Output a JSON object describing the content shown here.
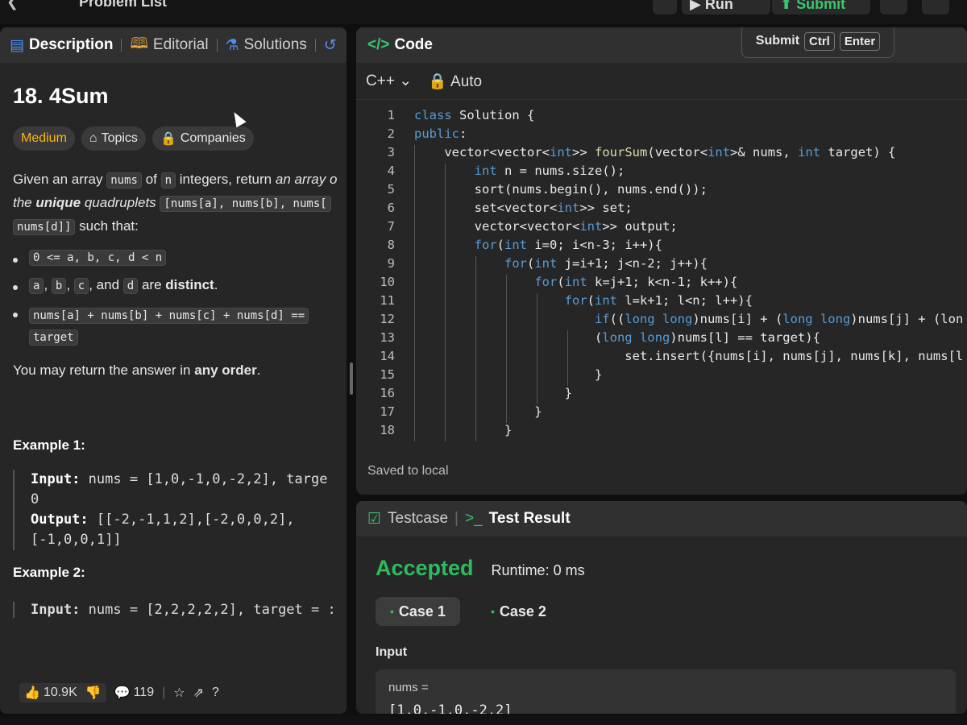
{
  "topbar": {
    "problem_list": "Problem List",
    "run": "Run",
    "submit": "Submit"
  },
  "left_tabs": [
    {
      "label": "Description",
      "icon": "document-icon"
    },
    {
      "label": "Editorial",
      "icon": "book-icon"
    },
    {
      "label": "Solutions",
      "icon": "flask-icon"
    },
    {
      "label": "",
      "icon": "history-icon"
    }
  ],
  "problem": {
    "title": "18. 4Sum",
    "difficulty": "Medium",
    "topics": "Topics",
    "companies": "Companies",
    "desc_1": "Given an array",
    "desc_nums": "nums",
    "desc_of": "of",
    "desc_n": "n",
    "desc_2": "integers, return",
    "desc_3": "an array o",
    "desc_4": "the",
    "desc_unique": "unique",
    "desc_5": "quadruplets",
    "desc_quad": "[nums[a], nums[b], nums[",
    "desc_quad2": "nums[d]]",
    "desc_6": "such that:",
    "bullet1": "0 <= a, b, c, d < n",
    "b2_a": "a",
    "b2_b": "b",
    "b2_c": "c",
    "b2_and": "and",
    "b2_d": "d",
    "b2_are": "are",
    "b2_distinct": "distinct",
    "bullet3": "nums[a] + nums[b] + nums[c] + nums[d] ==",
    "bullet3b": "target",
    "order_1": "You may return the answer in",
    "order_2": "any order",
    "example1_title": "Example 1:",
    "ex1_input_label": "Input:",
    "ex1_input": "nums = [1,0,-1,0,-2,2], targe",
    "ex1_input2": "0",
    "ex1_output_label": "Output:",
    "ex1_output": "[[-2,-1,1,2],[-2,0,0,2],",
    "ex1_output2": "[-1,0,0,1]]",
    "example2_title": "Example 2:",
    "ex2_input_label": "Input:",
    "ex2_input": "nums = [2,2,2,2,2], target = :"
  },
  "left_footer": {
    "likes": "10.9K",
    "comments": "119"
  },
  "code_panel": {
    "title": "Code",
    "submit_tip": "Submit",
    "kbd_ctrl": "Ctrl",
    "kbd_enter": "Enter",
    "language": "C++",
    "mode": "Auto",
    "saved": "Saved to local"
  },
  "code_lines": [
    "class Solution {",
    "public:",
    "    vector<vector<int>> fourSum(vector<int>& nums, int target) {",
    "        int n = nums.size();",
    "        sort(nums.begin(), nums.end());",
    "        set<vector<int>> set;",
    "        vector<vector<int>> output;",
    "        for(int i=0; i<n-3; i++){",
    "            for(int j=i+1; j<n-2; j++){",
    "                for(int k=j+1; k<n-1; k++){",
    "                    for(int l=k+1; l<n; l++){",
    "                        if((long long)nums[i] + (long long)nums[j] + (lon",
    "                        (long long)nums[l] == target){",
    "                            set.insert({nums[i], nums[j], nums[k], nums[l",
    "                        }",
    "                    }",
    "                }",
    "            }"
  ],
  "test_panel": {
    "testcase": "Testcase",
    "test_result": "Test Result",
    "status": "Accepted",
    "runtime": "Runtime: 0 ms",
    "case1": "Case 1",
    "case2": "Case 2",
    "input_label": "Input",
    "var_label": "nums =",
    "var_value": "[1,0,-1,0,-2,2]"
  },
  "colors": {
    "accepted": "#2cbb5d",
    "medium": "#ffb800",
    "keyword": "#569cd6",
    "type": "#4ec9b0"
  }
}
